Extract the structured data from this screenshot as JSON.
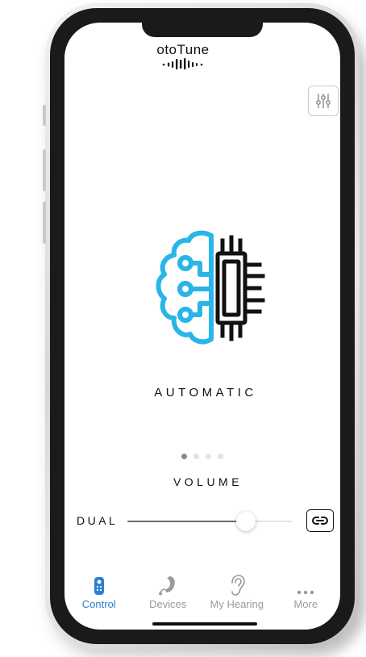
{
  "app": {
    "brand": "otoTune"
  },
  "header": {
    "equalizer_icon": "sliders-icon"
  },
  "mode": {
    "label": "AUTOMATIC",
    "icon": "brain-chip-icon",
    "colors": {
      "brain": "#29b5e8",
      "chip": "#111111"
    }
  },
  "pager": {
    "count": 4,
    "active_index": 0
  },
  "volume": {
    "title": "VOLUME",
    "side_label": "DUAL",
    "level": 0.72,
    "link_icon": "link-icon"
  },
  "tabs": [
    {
      "label": "Control",
      "icon": "remote-icon",
      "active": true
    },
    {
      "label": "Devices",
      "icon": "hearing-aid-icon",
      "active": false
    },
    {
      "label": "My Hearing",
      "icon": "ear-icon",
      "active": false
    },
    {
      "label": "More",
      "icon": "more-dots-icon",
      "active": false
    }
  ],
  "colors": {
    "accent": "#2a7fd4",
    "inactive": "#9a9a9a"
  }
}
